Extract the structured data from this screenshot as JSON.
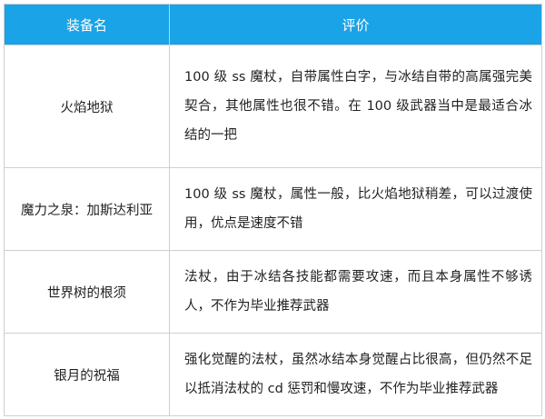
{
  "table": {
    "headers": [
      "装备名",
      "评价"
    ],
    "rows": [
      {
        "name": "火焰地狱",
        "desc": "100 级 ss 魔杖，自带属性白字，与冰结自带的高属强完美契合，其他属性也很不错。在 100 级武器当中是最适合冰结的一把"
      },
      {
        "name": "魔力之泉：加斯达利亚",
        "desc": "100 级 ss 魔杖，属性一般，比火焰地狱稍差，可以过渡使用，优点是速度不错"
      },
      {
        "name": "世界树的根须",
        "desc": "法杖，由于冰结各技能都需要攻速，而且本身属性不够诱人，不作为毕业推荐武器"
      },
      {
        "name": "银月的祝福",
        "desc": "强化觉醒的法杖，虽然冰结本身觉醒占比很高，但仍然不足以抵消法杖的 cd 惩罚和慢攻速，不作为毕业推荐武器"
      }
    ]
  },
  "colors": {
    "header_bg": "#1aa3e6",
    "header_text": "#ffffff",
    "border": "#cfcfcf"
  }
}
